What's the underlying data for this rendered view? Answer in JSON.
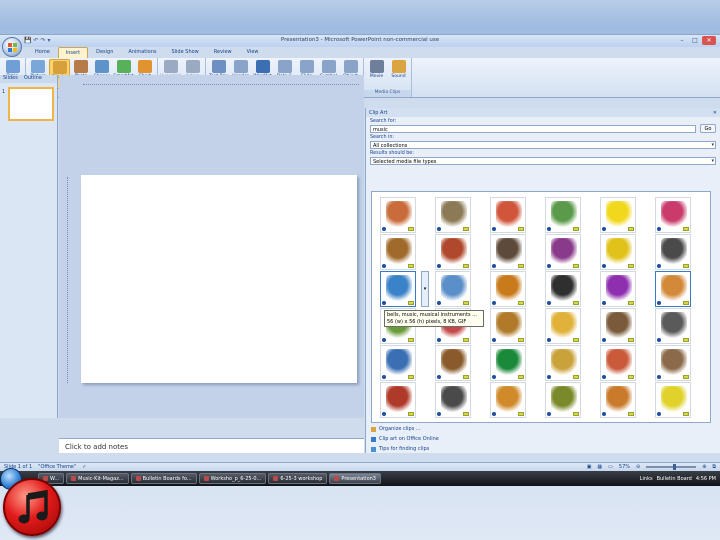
{
  "window": {
    "title": "Presentation3 - Microsoft PowerPoint non-commercial use",
    "controls": [
      "–",
      "□",
      "✕"
    ]
  },
  "qat": [
    "💾",
    "↶",
    "↷",
    "▾"
  ],
  "tabs": [
    "Home",
    "Insert",
    "Design",
    "Animations",
    "Slide Show",
    "Review",
    "View"
  ],
  "active_tab": "Insert",
  "ribbon": {
    "groups": [
      {
        "label": "Tables",
        "buttons": [
          {
            "label": "Table",
            "color": "#6f9fd6"
          }
        ]
      },
      {
        "label": "Illustrations",
        "buttons": [
          {
            "label": "Picture",
            "color": "#7aa7d9"
          },
          {
            "label": "Clip Art",
            "color": "#d8a03a"
          },
          {
            "label": "Photo Album",
            "color": "#b77b4a"
          },
          {
            "label": "Shapes",
            "color": "#5c93c9"
          },
          {
            "label": "SmartArt",
            "color": "#58b05a"
          },
          {
            "label": "Chart",
            "color": "#e0932f"
          }
        ]
      },
      {
        "label": "Links",
        "buttons": [
          {
            "label": "Hyperlink",
            "color": "#9aaac2"
          },
          {
            "label": "Action",
            "color": "#9aaac2"
          }
        ]
      },
      {
        "label": "Text",
        "buttons": [
          {
            "label": "Text Box",
            "color": "#6d8fc2"
          },
          {
            "label": "Header & Footer",
            "color": "#8aa3c8"
          },
          {
            "label": "WordArt",
            "color": "#3a6fb4"
          },
          {
            "label": "Date & Time",
            "color": "#8aa3c8"
          },
          {
            "label": "Slide Number",
            "color": "#8aa3c8"
          },
          {
            "label": "Symbol",
            "color": "#8aa3c8"
          },
          {
            "label": "Object",
            "color": "#8aa3c8"
          }
        ]
      },
      {
        "label": "Media Clips",
        "buttons": [
          {
            "label": "Movie",
            "color": "#6d7f9a"
          },
          {
            "label": "Sound",
            "color": "#d9a441"
          }
        ]
      }
    ]
  },
  "thumbs": {
    "tabs": [
      "Slides",
      "Outline"
    ],
    "slide_number": "1"
  },
  "notes_placeholder": "Click to add notes",
  "clipart": {
    "pane_title": "Clip Art",
    "search_for_label": "Search for:",
    "search_value": "music",
    "go_label": "Go",
    "search_in_label": "Search in:",
    "search_in_value": "All collections",
    "results_label": "Results should be:",
    "results_value": "Selected media file types",
    "tooltip_line1": "bells, music, musical instruments ...",
    "tooltip_line2": "56 (w) x 56 (h) pixels, 8 KB, GIF",
    "clip_colors": [
      "#c96b3a",
      "#8b7a55",
      "#d0553a",
      "#5a9a4a",
      "#f2d81c",
      "#c93b6a",
      "#a06a2b",
      "#b0492c",
      "#5e4a3a",
      "#8a3a8a",
      "#e0c21a",
      "#4a4a4a",
      "#3b83c9",
      "#5a8fc9",
      "#c97a1a",
      "#2f2f2f",
      "#8e2fb0",
      "#d28a3a",
      "#6a9a3a",
      "#c44a4a",
      "#b07a2a",
      "#e0b23a",
      "#7a5a3a",
      "#5a5a5a",
      "#3a6fb4",
      "#8a5a2a",
      "#1a8a3a",
      "#c9a23a",
      "#c95a3a",
      "#8a6a4a",
      "#b03a2a",
      "#4a4a4a",
      "#d08a2a",
      "#7a8a2a",
      "#c97a2a",
      "#e0d22a"
    ],
    "links": [
      "Organize clips ...",
      "Clip art on Office Online",
      "Tips for finding clips"
    ]
  },
  "status": {
    "slide": "Slide 1 of 1",
    "theme": "\"Office Theme\"",
    "zoom": "57%",
    "zoom_level": 0.57
  },
  "taskbar": {
    "items": [
      "W...",
      "Music-Kit-Magaz...",
      "Bulletin Boards fo...",
      "Worksho_p_6-25-0...",
      "6-25-3 workshop",
      "Presentation3"
    ],
    "active_index": 5,
    "tray": [
      "Links",
      "Bulletin Board",
      "4:56 PM"
    ]
  }
}
